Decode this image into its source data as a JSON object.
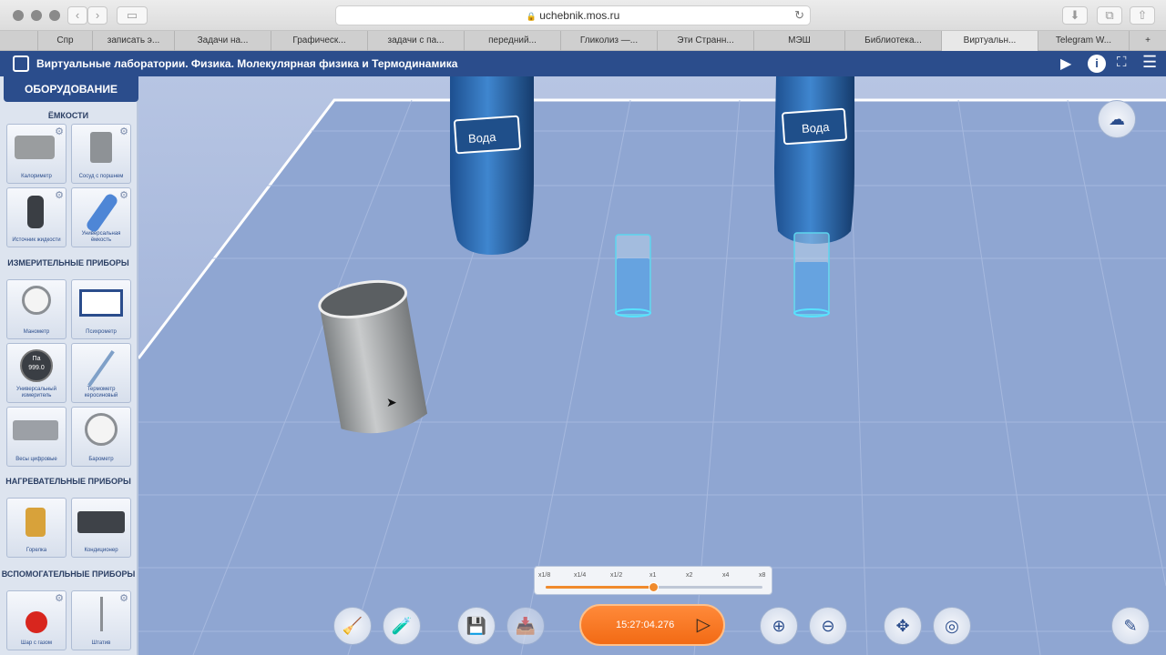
{
  "browser": {
    "url": "uchebnik.mos.ru",
    "tabs": [
      "Спр",
      "записать э...",
      "Задачи на...",
      "Графическ...",
      "задачи с па...",
      "передний...",
      "Гликолиз —...",
      "Эти Странн...",
      "МЭШ",
      "Библиотека...",
      "Виртуальн...",
      "Telegram W..."
    ],
    "active_tab_index": 10
  },
  "app": {
    "title": "Виртуальные лаборатории. Физика. Молекулярная физика и Термодинамика"
  },
  "sidebar": {
    "header": "ОБОРУДОВАНИЕ",
    "categories": [
      {
        "title": "ЁМКОСТИ",
        "items": [
          "Калориметр",
          "Сосуд с поршнем",
          "Источник жидкости",
          "Универсальная ёмкость"
        ]
      },
      {
        "title": "ИЗМЕРИТЕЛЬНЫЕ ПРИБОРЫ",
        "items": [
          "Манометр",
          "Психрометр",
          "Универсальный измеритель",
          "Термометр керосиновый",
          "Весы цифровые",
          "Барометр"
        ]
      },
      {
        "title": "НАГРЕВАТЕЛЬНЫЕ ПРИБОРЫ",
        "items": [
          "Горелка",
          "Кондиционер"
        ]
      },
      {
        "title": "ВСПОМОГАТЕЛЬНЫЕ ПРИБОРЫ",
        "items": [
          "Шар с газом",
          "Штатив"
        ]
      }
    ],
    "gauge_reading": "999.0",
    "gauge_unit": "Па"
  },
  "scene": {
    "bottle_label_1": "Вода",
    "bottle_label_2": "Вода"
  },
  "speed": {
    "options": [
      "x1/8",
      "x1/4",
      "x1/2",
      "x1",
      "x2",
      "x4",
      "x8"
    ],
    "selected": "x1",
    "level": 0.5
  },
  "timer": "15:27:04.276",
  "colors": {
    "accent": "#f26a14",
    "brand": "#2b4d8c"
  }
}
